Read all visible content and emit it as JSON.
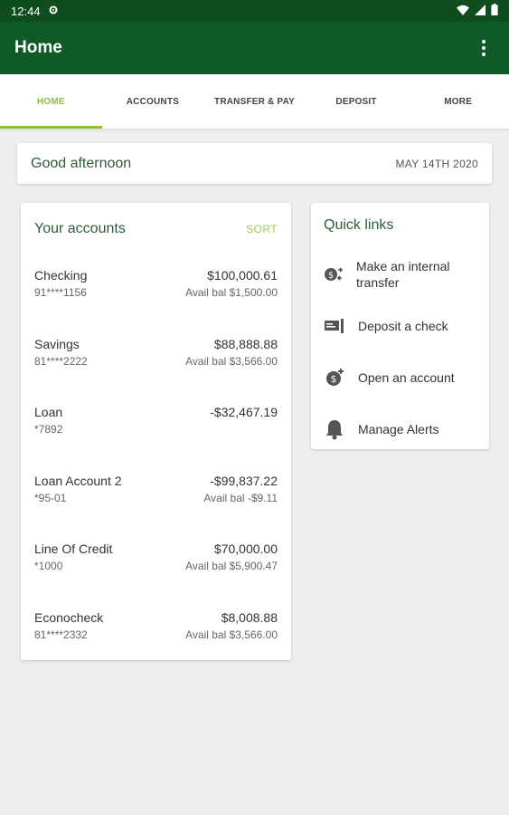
{
  "status_bar": {
    "time": "12:44"
  },
  "app_bar": {
    "title": "Home"
  },
  "tabs": [
    {
      "label": "HOME",
      "active": true
    },
    {
      "label": "ACCOUNTS",
      "active": false
    },
    {
      "label": "TRANSFER & PAY",
      "active": false
    },
    {
      "label": "DEPOSIT",
      "active": false
    },
    {
      "label": "MORE",
      "active": false
    }
  ],
  "greeting": {
    "text": "Good afternoon",
    "date": "MAY 14TH 2020"
  },
  "accounts": {
    "title": "Your accounts",
    "sort_label": "SORT",
    "items": [
      {
        "name": "Checking",
        "number": "91****1156",
        "amount": "$100,000.61",
        "avail": "Avail bal $1,500.00"
      },
      {
        "name": "Savings",
        "number": "81****2222",
        "amount": "$88,888.88",
        "avail": "Avail bal $3,566.00"
      },
      {
        "name": "Loan",
        "number": "*7892",
        "amount": "-$32,467.19",
        "avail": ""
      },
      {
        "name": "Loan Account 2",
        "number": "*95-01",
        "amount": "-$99,837.22",
        "avail": "Avail bal -$9.11"
      },
      {
        "name": "Line Of Credit",
        "number": "*1000",
        "amount": "$70,000.00",
        "avail": "Avail bal $5,900.47"
      },
      {
        "name": "Econocheck",
        "number": "81****2332",
        "amount": "$8,008.88",
        "avail": "Avail bal $3,566.00"
      }
    ]
  },
  "quick_links": {
    "title": "Quick links",
    "items": [
      {
        "label": "Make an internal transfer",
        "icon": "transfer-icon"
      },
      {
        "label": "Deposit a check",
        "icon": "check-deposit-icon"
      },
      {
        "label": "Open an account",
        "icon": "open-account-icon"
      },
      {
        "label": "Manage Alerts",
        "icon": "bell-icon"
      }
    ]
  },
  "colors": {
    "status_bar": "#0f4d1f",
    "app_bar": "#0f5a28",
    "accent": "#8cbf3f",
    "heading": "#2e5b3a"
  }
}
